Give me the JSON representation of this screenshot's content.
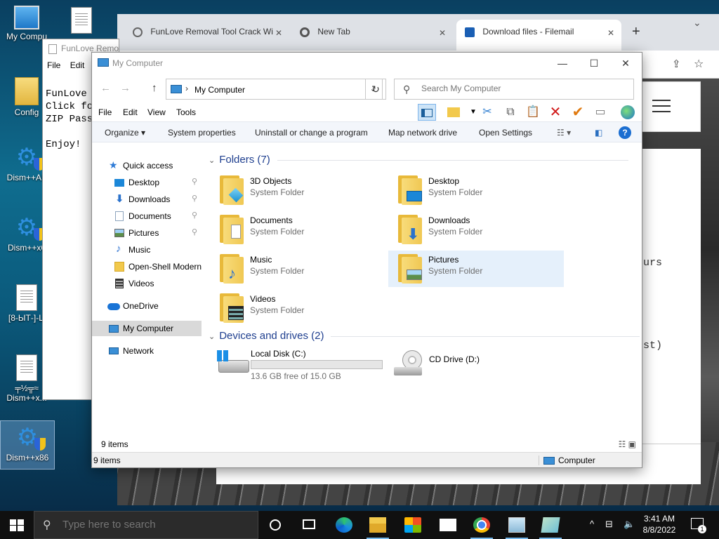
{
  "desktop": {
    "icons": [
      {
        "label": "My Compu"
      },
      {
        "label": "Config"
      },
      {
        "label": "Dism++AF"
      },
      {
        "label": "Dism++x6"
      },
      {
        "label": "[8-ЫТ-]-Ц"
      },
      {
        "label": "╤½╦≈ Dism++x..."
      },
      {
        "label": "Dism++x86"
      }
    ]
  },
  "browser": {
    "tabs": [
      {
        "label": "FunLove Removal Tool Crack Wi",
        "close": "✕"
      },
      {
        "label": "New Tab",
        "close": "✕"
      },
      {
        "label": "Download files - Filemail",
        "close": "✕"
      }
    ],
    "new_tab": "+",
    "tab_menu": "⌄",
    "peek_texts": [
      "urs",
      "st)"
    ]
  },
  "notepad": {
    "title": "FunLove Remo",
    "menu": [
      "File",
      "Edit"
    ],
    "text": "FunLove I\nClick fo\nZIP Passw\n\nEnjoy!"
  },
  "explorer": {
    "title": "My Computer",
    "controls": {
      "minimize": "—",
      "maximize": "☐",
      "close": "✕"
    },
    "nav": {
      "back": "←",
      "forward": "→",
      "up": "↑"
    },
    "address": {
      "separator": "›",
      "path": "My Computer",
      "dropdown": "⌄",
      "refresh": "↻"
    },
    "search": {
      "placeholder": "Search My Computer",
      "icon": "⚲"
    },
    "menu": [
      "File",
      "Edit",
      "View",
      "Tools"
    ],
    "commands": [
      "Organize ▾",
      "System properties",
      "Uninstall or change a program",
      "Map network drive",
      "Open Settings"
    ],
    "nav_pane": [
      {
        "label": "Quick access",
        "icon": "star-icon",
        "color": "#2f7bd6"
      },
      {
        "label": "Desktop",
        "icon": "desktop-icon",
        "pinned": true,
        "color": "#1b87d8"
      },
      {
        "label": "Downloads",
        "icon": "download-icon",
        "pinned": true,
        "color": "#2a72cc"
      },
      {
        "label": "Documents",
        "icon": "document-icon",
        "pinned": true,
        "color": "#8ea4bd"
      },
      {
        "label": "Pictures",
        "icon": "picture-icon",
        "pinned": true,
        "color": "#6fa8dc"
      },
      {
        "label": "Music",
        "icon": "music-icon",
        "color": "#2a6fd0"
      },
      {
        "label": "Open-Shell Modern",
        "icon": "folder-icon",
        "color": "#f2c94c"
      },
      {
        "label": "Videos",
        "icon": "video-icon",
        "color": "#3a4a7a"
      },
      {
        "label": "OneDrive",
        "icon": "cloud-icon",
        "color": "#1a74d6"
      },
      {
        "label": "My Computer",
        "icon": "computer-icon",
        "selected": true,
        "color": "#3a8fd6"
      },
      {
        "label": "Network",
        "icon": "network-icon",
        "color": "#3a8fd6"
      }
    ],
    "pin_glyph": "📌",
    "groups": {
      "folders": "Folders (7)",
      "devices": "Devices and drives (2)"
    },
    "folders": [
      {
        "name": "3D Objects",
        "type": "System Folder",
        "emblem": "cube-icon"
      },
      {
        "name": "Desktop",
        "type": "System Folder",
        "emblem": "desktop-icon"
      },
      {
        "name": "Documents",
        "type": "System Folder",
        "emblem": "document-icon"
      },
      {
        "name": "Downloads",
        "type": "System Folder",
        "emblem": "download-icon"
      },
      {
        "name": "Music",
        "type": "System Folder",
        "emblem": "music-icon"
      },
      {
        "name": "Pictures",
        "type": "System Folder",
        "emblem": "picture-icon",
        "selected": true
      },
      {
        "name": "Videos",
        "type": "System Folder",
        "emblem": "video-icon"
      }
    ],
    "drives": [
      {
        "name": "Local Disk (C:)",
        "free": "13.6 GB free of 15.0 GB",
        "used_fraction": 0.093
      },
      {
        "name": "CD Drive (D:)"
      }
    ],
    "status": {
      "count": "9 items",
      "count2": "9 items",
      "location": "Computer"
    }
  },
  "taskbar": {
    "search_placeholder": "Type here to search",
    "clock": {
      "time": "3:41 AM",
      "date": "8/8/2022"
    },
    "notifications": "1",
    "tray_chevron": "^"
  },
  "colors": {
    "accent": "#0078d7",
    "selection": "#e5f0fb",
    "group_header": "#1f3f8f",
    "drive_bar": "#26a0da"
  }
}
